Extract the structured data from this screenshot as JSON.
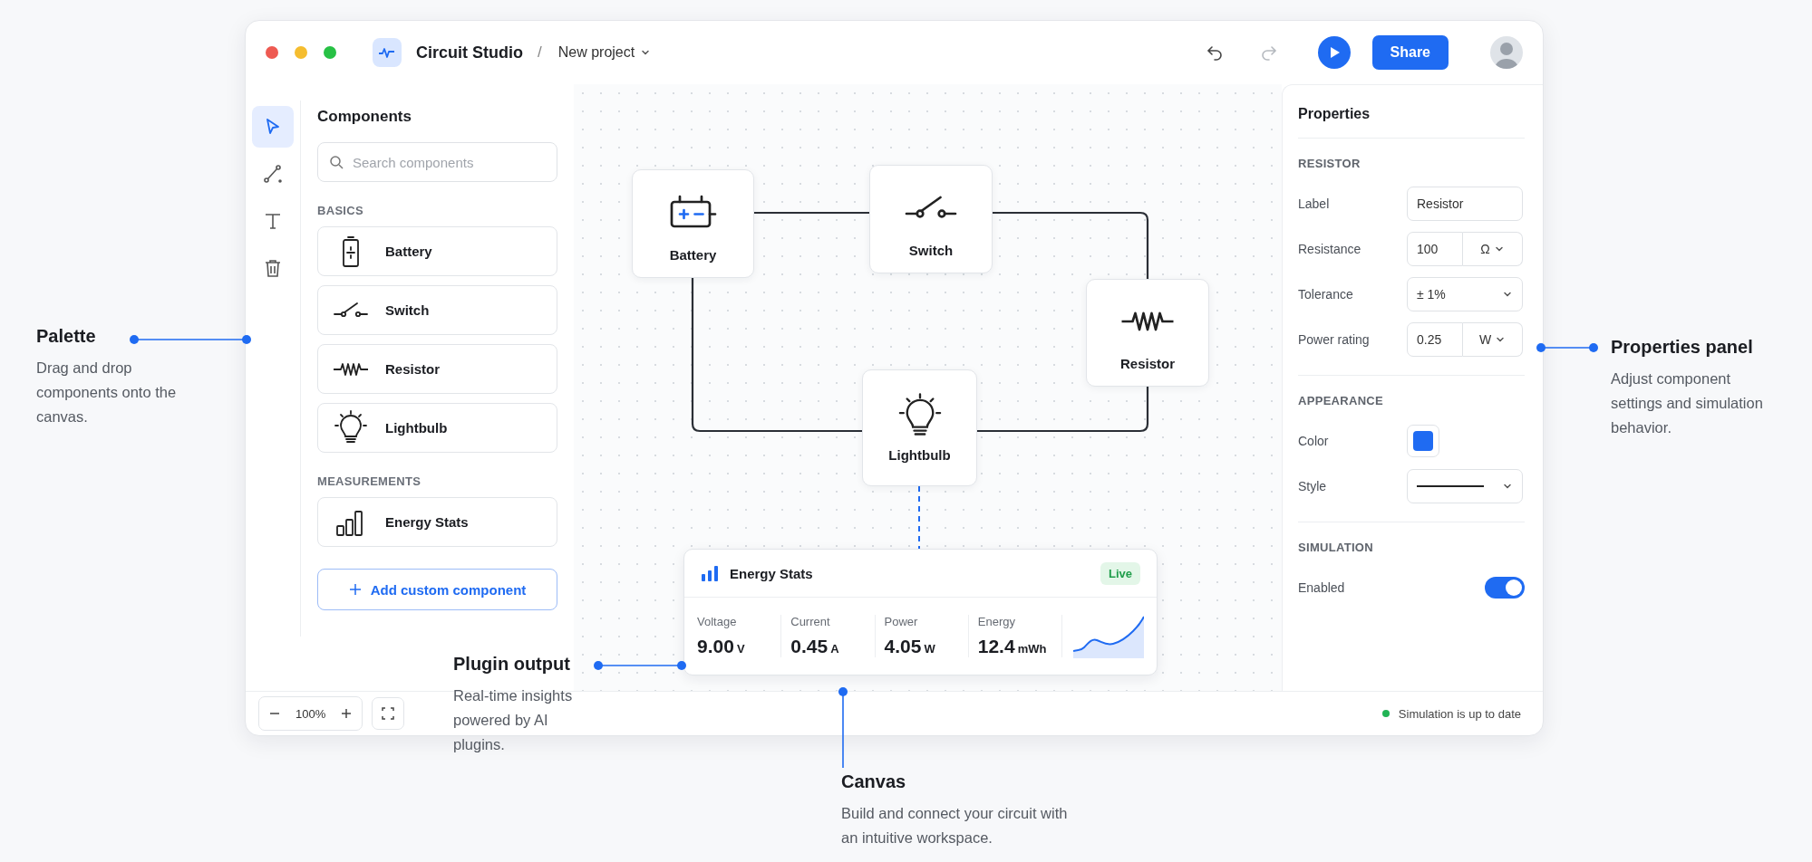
{
  "window": {
    "title": "Circuit Studio",
    "separator": "/",
    "breadcrumb": "New project"
  },
  "toolbar": {
    "share_label": "Share"
  },
  "tools": [
    {
      "kind": "select",
      "selected": true
    },
    {
      "kind": "wire",
      "selected": false
    },
    {
      "kind": "text",
      "selected": false
    },
    {
      "kind": "delete",
      "selected": false
    }
  ],
  "components_panel": {
    "title": "Components",
    "search": {
      "placeholder": "Search components"
    },
    "sections": [
      {
        "title": "BASICS",
        "items": [
          {
            "label": "Battery",
            "kind": "battery"
          },
          {
            "label": "Switch",
            "kind": "switch"
          },
          {
            "label": "Resistor",
            "kind": "resistor"
          },
          {
            "label": "Lightbulb",
            "kind": "lightbulb"
          }
        ]
      },
      {
        "title": "MEASUREMENTS",
        "items": [
          {
            "label": "Energy Stats",
            "kind": "stats"
          }
        ]
      }
    ],
    "add_button": "Add custom component"
  },
  "zoom": {
    "value": "100%"
  },
  "canvas": {
    "nodes": [
      {
        "label": "Battery",
        "kind": "battery"
      },
      {
        "label": "Switch",
        "kind": "switch"
      },
      {
        "label": "Resistor",
        "kind": "resistor"
      },
      {
        "label": "Lightbulb",
        "kind": "lightbulb"
      }
    ],
    "energy_card": {
      "title": "Energy Stats",
      "badge": "Live",
      "metrics": [
        {
          "label": "Voltage",
          "value": "9.00",
          "unit": "V"
        },
        {
          "label": "Current",
          "value": "0.45",
          "unit": "A"
        },
        {
          "label": "Power",
          "value": "4.05",
          "unit": "W"
        },
        {
          "label": "Energy",
          "value": "12.4",
          "unit": "mWh"
        }
      ]
    }
  },
  "properties": {
    "title": "Properties",
    "sections": [
      {
        "title": "RESISTOR",
        "fields": [
          {
            "label": "Label",
            "kind": "text",
            "value": "Resistor"
          },
          {
            "label": "Resistance",
            "kind": "unit",
            "value": "100",
            "unit": "Ω"
          },
          {
            "label": "Tolerance",
            "kind": "select",
            "value": "± 1%"
          },
          {
            "label": "Power rating",
            "kind": "unit",
            "value": "0.25",
            "unit": "W"
          }
        ]
      },
      {
        "title": "APPEARANCE",
        "fields": [
          {
            "label": "Color",
            "kind": "color",
            "color": "#1f6bf2"
          },
          {
            "label": "Style",
            "kind": "line_style"
          }
        ]
      },
      {
        "title": "SIMULATION",
        "fields": [
          {
            "label": "Enabled",
            "kind": "toggle",
            "on": true
          }
        ]
      }
    ]
  },
  "status_bar": {
    "text": "Simulation is up to date"
  },
  "callouts": [
    {
      "title": "Palette",
      "text": "Drag and drop components onto the canvas."
    },
    {
      "title": "Properties panel",
      "text": "Adjust component settings and simulation behavior."
    },
    {
      "title": "Plugin output",
      "text": "Real-time insights powered by AI plugins."
    },
    {
      "title": "Canvas",
      "text": "Build and connect your circuit with an intuitive workspace."
    }
  ]
}
